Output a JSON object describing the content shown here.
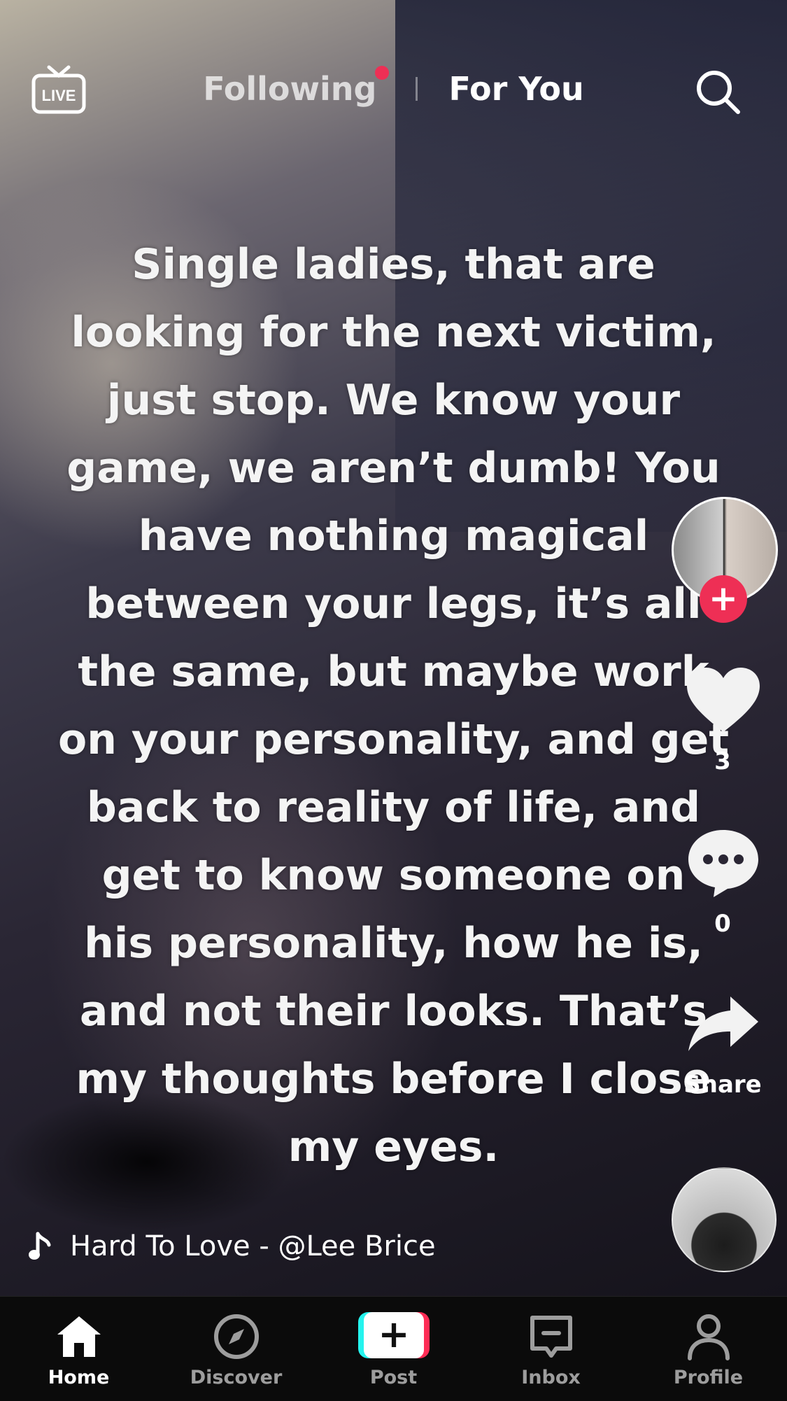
{
  "top_bar": {
    "live_label": "LIVE",
    "tabs": [
      {
        "label": "Following",
        "has_notification_dot": true
      },
      {
        "label": "For You",
        "active": true
      }
    ],
    "search_icon": "search-icon"
  },
  "caption": {
    "lines": [
      "Single ladies, that are",
      "looking for the next victim,",
      "just stop. We know your",
      "game, we aren’t dumb! You",
      "have nothing magical",
      "between your legs, it’s all",
      "the same, but maybe work",
      "on your personality, and get",
      "back to reality of life, and",
      "get to know someone on",
      "his personality, how he is,",
      "and not their looks. That’s",
      "my thoughts before I close",
      "my eyes."
    ]
  },
  "rail": {
    "follow_symbol": "+",
    "likes": "3",
    "comments": "0",
    "share_label": "Share",
    "icons": [
      "heart-icon",
      "comment-icon",
      "share-icon"
    ]
  },
  "music": {
    "text": "Hard To Love - @Lee Brice",
    "icon": "music-note-icon"
  },
  "bottom_nav": {
    "items": [
      {
        "label": "Home",
        "icon": "home-icon",
        "active": true
      },
      {
        "label": "Discover",
        "icon": "compass-icon"
      },
      {
        "label": "Post",
        "icon": "plus-icon",
        "symbol": "+"
      },
      {
        "label": "Inbox",
        "icon": "inbox-icon"
      },
      {
        "label": "Profile",
        "icon": "person-icon"
      }
    ]
  },
  "colors": {
    "accent_red": "#ee2f55",
    "post_cyan": "#25f4ee",
    "post_pink": "#fe2c55",
    "nav_bg": "#0b0b0b"
  }
}
